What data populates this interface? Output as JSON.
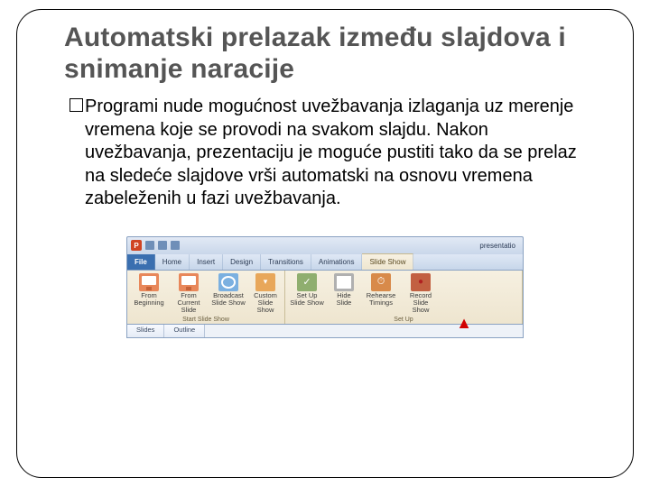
{
  "title": "Automatski prelazak između slajdova i snimanje naracije",
  "body": "Programi nude mogućnost uvežbavanja izlaganja uz merenje vremena koje se provodi na svakom slajdu. Nakon uvežbavanja, prezentaciju je moguće pustiti tako da se prelaz na sledeće slajdove vrši automatski na osnovu vremena zabeleženih u fazi uvežbavanja.",
  "qat": {
    "logo": "P",
    "doc_title": "presentatio"
  },
  "tabs": {
    "file": "File",
    "items": [
      "Home",
      "Insert",
      "Design",
      "Transitions",
      "Animations",
      "Slide Show"
    ]
  },
  "ribbon": {
    "group1": {
      "name": "Start Slide Show",
      "buttons": [
        {
          "label": "From\nBeginning"
        },
        {
          "label": "From\nCurrent Slide"
        },
        {
          "label": "Broadcast\nSlide Show"
        },
        {
          "label": "Custom\nSlide Show"
        }
      ]
    },
    "group2": {
      "name": "Set Up",
      "buttons": [
        {
          "label": "Set Up\nSlide Show"
        },
        {
          "label": "Hide\nSlide"
        },
        {
          "label": "Rehearse\nTimings"
        },
        {
          "label": "Record Slide\nShow"
        }
      ]
    }
  },
  "secondary_tabs": [
    "Slides",
    "Outline"
  ]
}
